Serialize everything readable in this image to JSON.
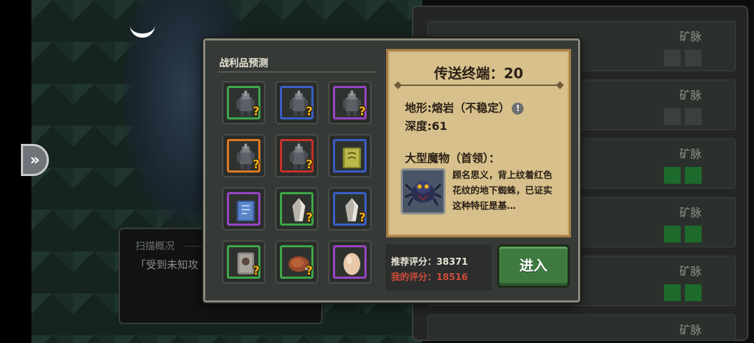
{
  "scan_panel": {
    "title": "扫描概况",
    "text": "「受到未知攻"
  },
  "vein_list": {
    "rows": [
      {
        "label": "矿脉",
        "squares": [
          "#3c403c",
          "#3c403c"
        ]
      },
      {
        "label": "矿脉",
        "squares": [
          "#3c403c",
          "#3c403c"
        ]
      },
      {
        "label": "矿脉",
        "squares": [
          "#1e6a2c",
          "#1e6a2c"
        ]
      },
      {
        "label": "矿脉",
        "squares": [
          "#1e6a2c",
          "#1e6a2c"
        ]
      },
      {
        "label": "矿脉",
        "squares": [
          "#1e6a2c",
          "#1e6a2c"
        ]
      },
      {
        "label": "矿脉",
        "squares": []
      }
    ]
  },
  "dialog": {
    "loot_title": "战利品预测",
    "loot_slots": [
      {
        "icon": "armor-unknown-icon",
        "rarity_color": "#3ea84a",
        "question": "?"
      },
      {
        "icon": "armor-unknown-icon",
        "rarity_color": "#3a5fc8",
        "question": "?"
      },
      {
        "icon": "armor-unknown-icon",
        "rarity_color": "#9a44c8",
        "question": "?"
      },
      {
        "icon": "armor-unknown-icon",
        "rarity_color": "#e07a22",
        "question": "?"
      },
      {
        "icon": "armor-unknown-icon",
        "rarity_color": "#c8322a",
        "question": "?"
      },
      {
        "icon": "spellbook-icon",
        "rarity_color": "#3a5fc8",
        "question": ""
      },
      {
        "icon": "rune-tome-icon",
        "rarity_color": "#9a44c8",
        "question": ""
      },
      {
        "icon": "crystal-unknown-icon",
        "rarity_color": "#3ea84a",
        "question": "?"
      },
      {
        "icon": "crystal-unknown-icon",
        "rarity_color": "#3a5fc8",
        "question": "?"
      },
      {
        "icon": "card-unknown-icon",
        "rarity_color": "#3ea84a",
        "question": "?"
      },
      {
        "icon": "meat-unknown-icon",
        "rarity_color": "#3ea84a",
        "question": "?"
      },
      {
        "icon": "egg-icon",
        "rarity_color": "#9a44c8",
        "question": ""
      }
    ],
    "info": {
      "title": "传送终端：20",
      "terrain": "地形:熔岩（不稳定）",
      "depth": "深度:61",
      "boss_heading": "大型魔物（首领）：",
      "boss_desc": "顾名思义，背上纹着红色花纹的地下蜘蛛，已证实这种特征是基…"
    },
    "rating": {
      "recommended": "推荐评分：38371",
      "mine": "我的评分：18516"
    },
    "enter_label": "进入"
  },
  "colors": {
    "parchment": "#d7c08b",
    "enter_green": "#3e7a3f",
    "my_rating_red": "#d04a3a",
    "question_gold": "#f2b21a"
  }
}
